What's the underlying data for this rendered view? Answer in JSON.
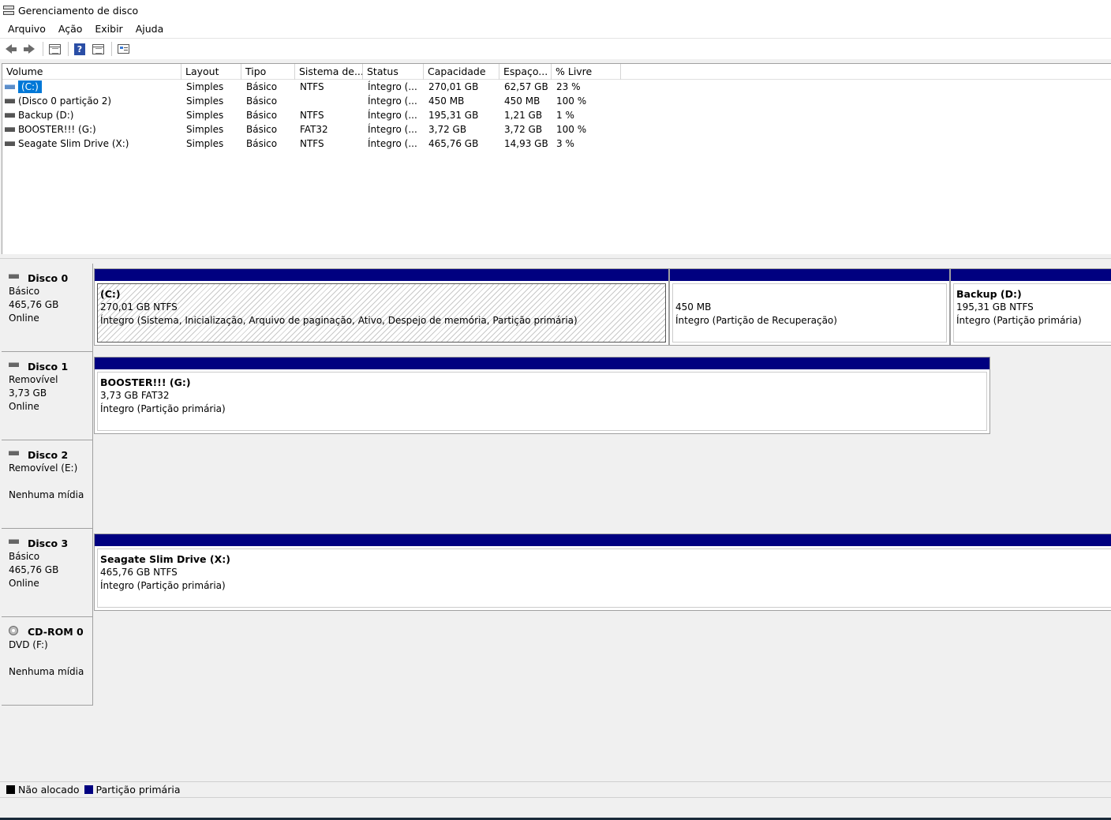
{
  "window": {
    "title": "Gerenciamento de disco"
  },
  "menu": [
    "Arquivo",
    "Ação",
    "Exibir",
    "Ajuda"
  ],
  "toolbar": [
    "back-icon",
    "forward-icon",
    "list-view-icon",
    "help-icon",
    "grid-icon",
    "properties-icon"
  ],
  "volumes": {
    "headers": [
      "Volume",
      "Layout",
      "Tipo",
      "Sistema de...",
      "Status",
      "Capacidade",
      "Espaço...",
      "% Livre"
    ],
    "rows": [
      {
        "volume": "(C:)",
        "layout": "Simples",
        "tipo": "Básico",
        "fs": "NTFS",
        "status": "Íntegro (...",
        "cap": "270,01 GB",
        "free": "62,57 GB",
        "pct": "23 %",
        "selected": true
      },
      {
        "volume": "(Disco 0 partição 2)",
        "layout": "Simples",
        "tipo": "Básico",
        "fs": "",
        "status": "Íntegro (...",
        "cap": "450 MB",
        "free": "450 MB",
        "pct": "100 %"
      },
      {
        "volume": "Backup (D:)",
        "layout": "Simples",
        "tipo": "Básico",
        "fs": "NTFS",
        "status": "Íntegro (...",
        "cap": "195,31 GB",
        "free": "1,21 GB",
        "pct": "1 %"
      },
      {
        "volume": "BOOSTER!!! (G:)",
        "layout": "Simples",
        "tipo": "Básico",
        "fs": "FAT32",
        "status": "Íntegro (...",
        "cap": "3,72 GB",
        "free": "3,72 GB",
        "pct": "100 %"
      },
      {
        "volume": "Seagate Slim Drive (X:)",
        "layout": "Simples",
        "tipo": "Básico",
        "fs": "NTFS",
        "status": "Íntegro (...",
        "cap": "465,76 GB",
        "free": "14,93 GB",
        "pct": "3 %"
      }
    ]
  },
  "disks": [
    {
      "name": "Disco 0",
      "lines": [
        "Básico",
        "465,76 GB",
        "Online"
      ],
      "partitions": [
        {
          "title": "(C:)",
          "size": "270,01 GB NTFS",
          "status": "Íntegro (Sistema, Inicialização, Arquivo de paginação, Ativo, Despejo de memória, Partição primária)"
        },
        {
          "title": "",
          "size": "450 MB",
          "status": "Íntegro (Partição de Recuperação)"
        },
        {
          "title": "Backup  (D:)",
          "size": "195,31 GB NTFS",
          "status": "Íntegro (Partição primária)"
        }
      ]
    },
    {
      "name": "Disco 1",
      "lines": [
        "Removível",
        "3,73 GB",
        "Online"
      ],
      "partitions": [
        {
          "title": "BOOSTER!!!  (G:)",
          "size": "3,73 GB FAT32",
          "status": "Íntegro (Partição primária)"
        }
      ]
    },
    {
      "name": "Disco 2",
      "lines": [
        "Removível (E:)",
        "",
        "Nenhuma mídia"
      ],
      "partitions": []
    },
    {
      "name": "Disco 3",
      "lines": [
        "Básico",
        "465,76 GB",
        "Online"
      ],
      "partitions": [
        {
          "title": "Seagate Slim Drive  (X:)",
          "size": "465,76 GB NTFS",
          "status": "Íntegro (Partição primária)"
        }
      ]
    },
    {
      "name": "CD-ROM 0",
      "lines": [
        "DVD (F:)",
        "",
        "Nenhuma mídia"
      ],
      "partitions": []
    }
  ],
  "legend": [
    {
      "label": "Não alocado",
      "color": "#000000"
    },
    {
      "label": "Partição primária",
      "color": "#000080"
    }
  ]
}
